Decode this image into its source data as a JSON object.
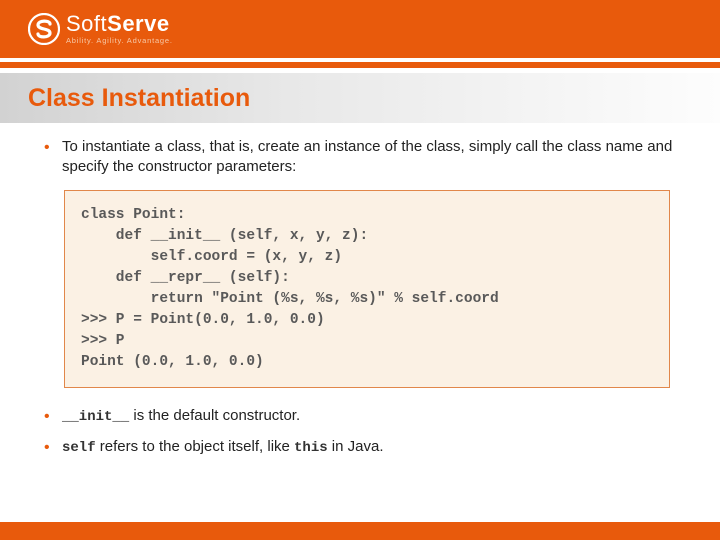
{
  "logo": {
    "name_light": "Soft",
    "name_bold": "Serve",
    "tagline": "Ability. Agility. Advantage."
  },
  "title": "Class Instantiation",
  "bullets": {
    "b1": "To instantiate a class, that is, create an instance of the class, simply call the class name and specify the constructor parameters:",
    "b2_code": "__init__",
    "b2_rest": " is the default constructor.",
    "b3_code1": "self",
    "b3_mid": " refers to the object itself, like ",
    "b3_code2": "this",
    "b3_end": " in Java."
  },
  "code": "class Point:\n    def __init__ (self, x, y, z):\n        self.coord = (x, y, z)\n    def __repr__ (self):\n        return \"Point (%s, %s, %s)\" % self.coord\n>>> P = Point(0.0, 1.0, 0.0)\n>>> P\nPoint (0.0, 1.0, 0.0)"
}
